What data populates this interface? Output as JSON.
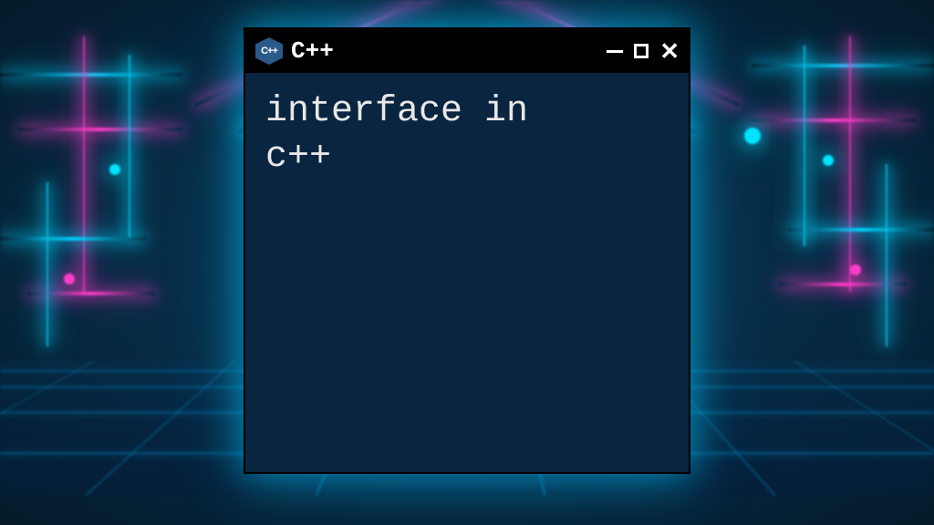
{
  "window": {
    "title": "C++",
    "icon_label": "C++",
    "body_text": "interface in\nc++"
  }
}
